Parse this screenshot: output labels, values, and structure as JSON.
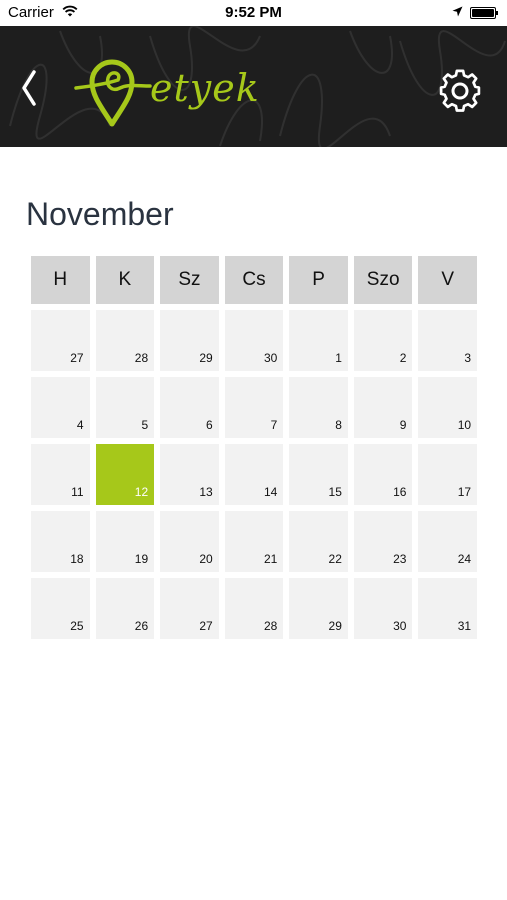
{
  "status_bar": {
    "carrier": "Carrier",
    "time": "9:52 PM"
  },
  "header": {
    "logo_text": "etyek",
    "accent_color": "#a6c81a",
    "back_icon": "chevron-left-icon",
    "settings_icon": "gear-icon"
  },
  "calendar": {
    "month": "November",
    "weekdays": [
      "H",
      "K",
      "Sz",
      "Cs",
      "P",
      "Szo",
      "V"
    ],
    "weeks": [
      [
        "27",
        "28",
        "29",
        "30",
        "1",
        "2",
        "3"
      ],
      [
        "4",
        "5",
        "6",
        "7",
        "8",
        "9",
        "10"
      ],
      [
        "11",
        "12",
        "13",
        "14",
        "15",
        "16",
        "17"
      ],
      [
        "18",
        "19",
        "20",
        "21",
        "22",
        "23",
        "24"
      ],
      [
        "25",
        "26",
        "27",
        "28",
        "29",
        "30",
        "31"
      ]
    ],
    "selected_day": "12"
  }
}
